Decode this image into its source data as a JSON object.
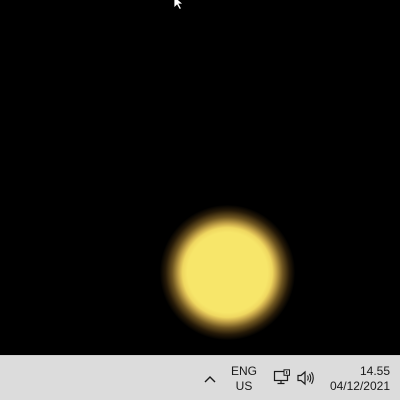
{
  "desktop": {
    "glow_color": "#f7e66a",
    "background_color": "#000000"
  },
  "cursor": {
    "icon": "arrow-cursor-icon"
  },
  "taskbar": {
    "background_color": "#dcdcdc",
    "tray_chevron_icon": "chevron-up-icon",
    "language": {
      "line1": "ENG",
      "line2": "US"
    },
    "network_icon": "network-icon",
    "volume_icon": "volume-icon",
    "clock": {
      "time": "14.55",
      "date": "04/12/2021"
    }
  }
}
